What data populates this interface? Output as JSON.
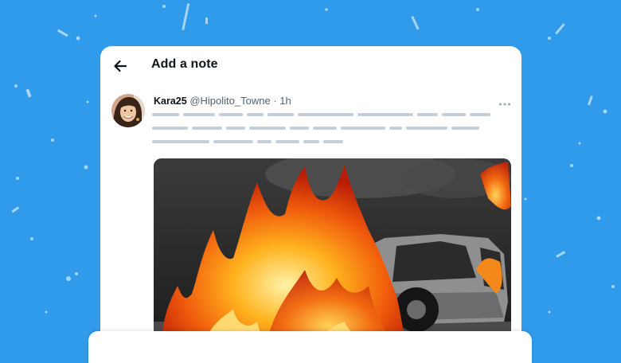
{
  "colors": {
    "background": "#2f9bea",
    "card": "#ffffff",
    "text_primary": "#0f1419",
    "text_secondary": "#536471",
    "placeholder_line": "#c5ced6"
  },
  "header": {
    "back_icon": "arrow-left-icon",
    "title": "Add a note"
  },
  "post": {
    "display_name": "Kara25",
    "handle": "@Hipolito_Towne",
    "separator": "·",
    "time": "1h",
    "more_icon": "more-horizontal-icon",
    "media_icon": "burning-car-photo"
  }
}
